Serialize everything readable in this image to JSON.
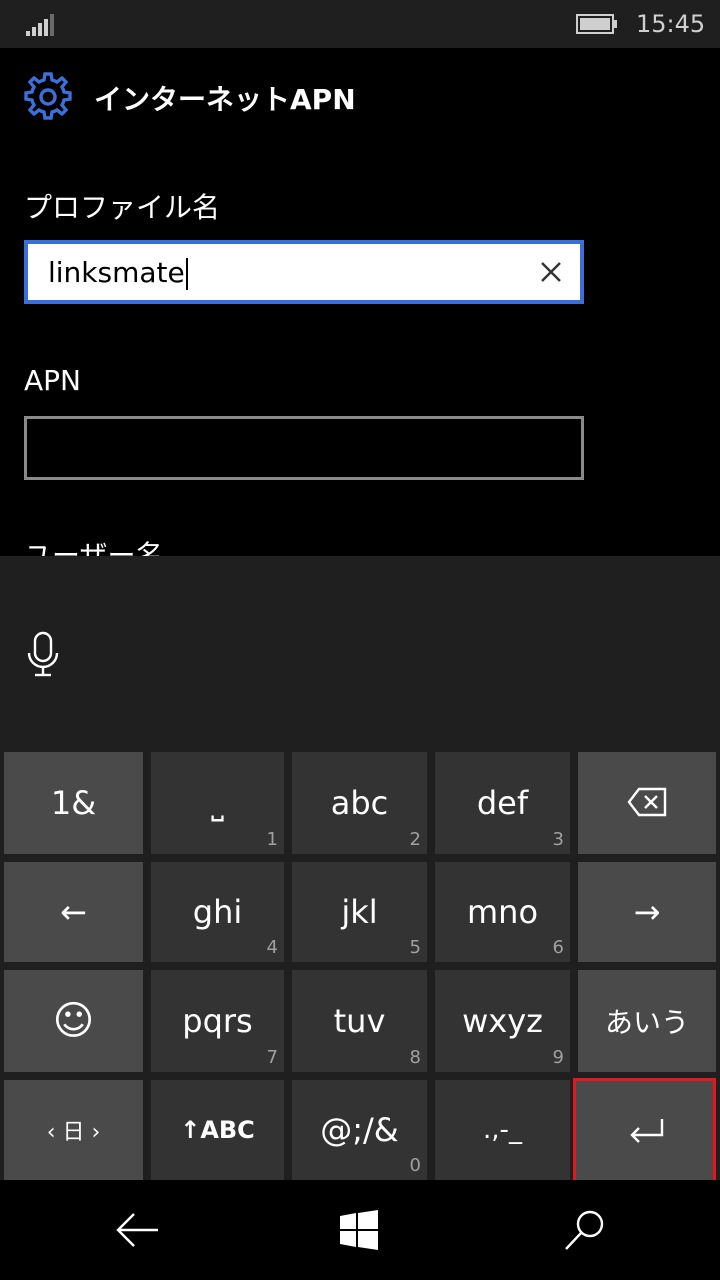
{
  "status_bar": {
    "time": "15:45",
    "signal_icon": "signal-icon",
    "battery_icon": "battery-icon"
  },
  "header": {
    "icon": "gear-icon",
    "title": "インターネットAPN",
    "accent": "#3b6fd9"
  },
  "form": {
    "profile_name_label": "プロファイル名",
    "profile_name_value": "linksmate",
    "apn_label": "APN",
    "apn_value": "",
    "username_label_partial": "ユーザー名"
  },
  "keyboard": {
    "mic_icon": "microphone-icon",
    "rows": [
      [
        {
          "label": "1&",
          "num": ""
        },
        {
          "label": "⎵",
          "num": "1"
        },
        {
          "label": "abc",
          "num": "2"
        },
        {
          "label": "def",
          "num": "3"
        },
        {
          "label": "⌫",
          "num": ""
        }
      ],
      [
        {
          "label": "←",
          "num": ""
        },
        {
          "label": "ghi",
          "num": "4"
        },
        {
          "label": "jkl",
          "num": "5"
        },
        {
          "label": "mno",
          "num": "6"
        },
        {
          "label": "→",
          "num": ""
        }
      ],
      [
        {
          "label": "☺",
          "num": ""
        },
        {
          "label": "pqrs",
          "num": "7"
        },
        {
          "label": "tuv",
          "num": "8"
        },
        {
          "label": "wxyz",
          "num": "9"
        },
        {
          "label": "あいう",
          "num": ""
        }
      ],
      [
        {
          "label": "‹ 日 ›",
          "num": ""
        },
        {
          "label": "↑ABC",
          "num": ""
        },
        {
          "label": "@;/&",
          "num": "0"
        },
        {
          "label": ".,-_",
          "num": ""
        },
        {
          "label": "↵",
          "num": ""
        }
      ]
    ],
    "highlight_color": "#e8141e"
  },
  "navbar": {
    "back_icon": "back-arrow-icon",
    "home_icon": "windows-logo-icon",
    "search_icon": "search-icon"
  }
}
